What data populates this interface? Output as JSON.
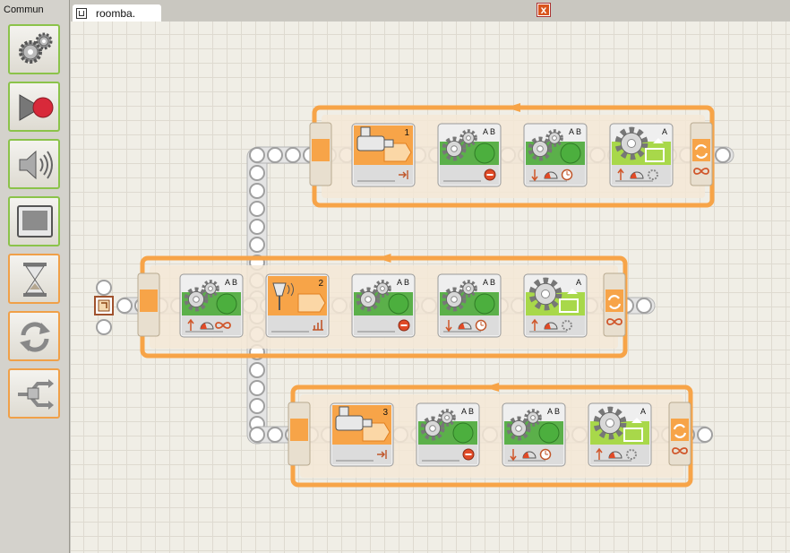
{
  "palette": {
    "title": "Commun",
    "items": [
      {
        "name": "palette-move-block",
        "icon": "gears-icon"
      },
      {
        "name": "palette-record-play-block",
        "icon": "record-icon"
      },
      {
        "name": "palette-sound-block",
        "icon": "speaker-icon"
      },
      {
        "name": "palette-display-block",
        "icon": "display-icon"
      },
      {
        "name": "palette-wait-block",
        "icon": "hourglass-icon"
      },
      {
        "name": "palette-loop-block",
        "icon": "loop-icon"
      },
      {
        "name": "palette-switch-block",
        "icon": "switch-icon"
      }
    ]
  },
  "tab": {
    "label": "roomba.",
    "icon": "program-icon"
  },
  "close": {
    "label": "x"
  },
  "program": {
    "rows": [
      {
        "blocks": [
          {
            "type": "sensor",
            "label": "1",
            "foot": "arrow-in-icon"
          },
          {
            "type": "motor",
            "ports": "A B",
            "foot": [
              "stop-icon"
            ]
          },
          {
            "type": "motor",
            "ports": "A B",
            "foot": [
              "down-arrow-icon",
              "speed-icon",
              "time-icon"
            ]
          },
          {
            "type": "motorL",
            "ports": "A",
            "foot": [
              "up-arrow-icon",
              "speed-icon",
              "rotation-icon"
            ]
          }
        ],
        "loop_end": "infinity-icon"
      },
      {
        "blocks": [
          {
            "type": "motor",
            "ports": "A B",
            "foot": [
              "up-arrow-icon",
              "speed-icon",
              "infinity-icon"
            ]
          },
          {
            "type": "soundsensor",
            "label": "2",
            "foot": "level-icon"
          },
          {
            "type": "motor",
            "ports": "A B",
            "foot": [
              "stop-icon"
            ]
          },
          {
            "type": "motor",
            "ports": "A B",
            "foot": [
              "down-arrow-icon",
              "speed-icon",
              "time-icon"
            ]
          },
          {
            "type": "motorL",
            "ports": "A",
            "foot": [
              "up-arrow-icon",
              "speed-icon",
              "rotation-icon"
            ]
          }
        ],
        "loop_end": "infinity-icon"
      },
      {
        "blocks": [
          {
            "type": "sensor",
            "label": "3",
            "foot": "arrow-in-icon"
          },
          {
            "type": "motor",
            "ports": "A B",
            "foot": [
              "stop-icon"
            ]
          },
          {
            "type": "motor",
            "ports": "A B",
            "foot": [
              "down-arrow-icon",
              "speed-icon",
              "time-icon"
            ]
          },
          {
            "type": "motorL",
            "ports": "A",
            "foot": [
              "up-arrow-icon",
              "speed-icon",
              "rotation-icon"
            ]
          }
        ],
        "loop_end": "infinity-icon"
      }
    ]
  },
  "colors": {
    "accent": "#f7a448",
    "loop_fill": "#f5e8d6",
    "motor_green": "#5bb04a",
    "motor_lime": "#a8d84a",
    "stop_red": "#e04a26"
  }
}
